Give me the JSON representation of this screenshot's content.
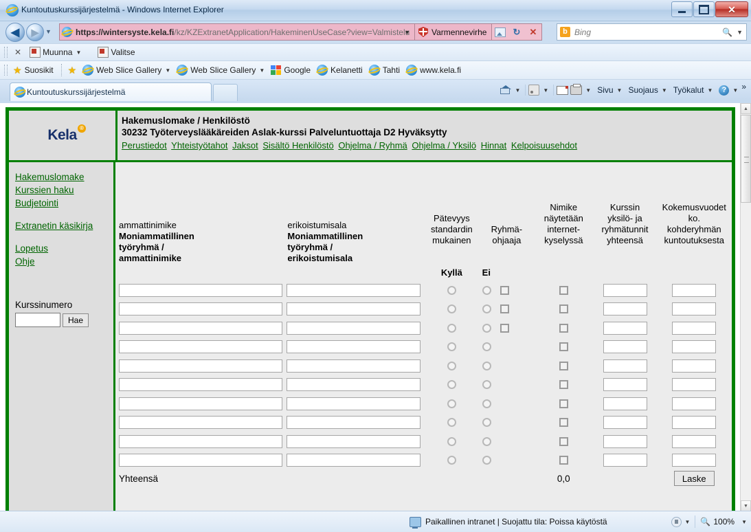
{
  "window": {
    "title": "Kuntoutuskurssijärjestelmä - Windows Internet Explorer",
    "minimize_label": "",
    "maximize_label": "",
    "close_label": "✕"
  },
  "navbar": {
    "back_label": "◀",
    "forward_label": "▶",
    "history_caret": "▼",
    "url_scheme": "https://",
    "url_host": "wintersyste.kela.fi",
    "url_path": "/kz/KZExtranetApplication/HakeminenUseCase?view=Valmistelu",
    "url_full": "https://wintersyste.kela.fi/kz/KZExtranetApplication/HakeminenUseCase?view=Valmistelu",
    "address_caret": "▼",
    "certificate_error": "Varmennevirhe",
    "compat_view_icon": "compatibility-view-icon",
    "refresh_icon": "↻",
    "stop_icon": "✕",
    "search_engine": "Bing",
    "search_placeholder": "Bing",
    "search_icon": "🔍",
    "search_caret": "▼"
  },
  "pdf_toolbar": {
    "close_label": "✕",
    "convert_label": "Muunna",
    "convert_caret": "▼",
    "select_label": "Valitse"
  },
  "favorites_bar": {
    "favorites_label": "Suosikit",
    "items": [
      {
        "label": "Web Slice Gallery",
        "caret": "▼"
      },
      {
        "label": "Web Slice Gallery",
        "caret": "▼"
      },
      {
        "label": "Google",
        "caret": ""
      },
      {
        "label": "Kelanetti",
        "caret": ""
      },
      {
        "label": "Tahti",
        "caret": ""
      },
      {
        "label": "www.kela.fi",
        "caret": ""
      }
    ]
  },
  "tabs": {
    "items": [
      {
        "label": "Kuntoutuskurssijärjestelmä"
      }
    ],
    "new_tab_label": ""
  },
  "command_bar": {
    "home_caret": "▼",
    "feeds_caret": "▼",
    "mail_caret": "▼",
    "print_caret": "▼",
    "page_label": "Sivu",
    "page_caret": "▼",
    "safety_label": "Suojaus",
    "safety_caret": "▼",
    "tools_label": "Työkalut",
    "tools_caret": "▼",
    "help_caret": "▼",
    "overflow_label": "»"
  },
  "page": {
    "brand": {
      "name": "Kela",
      "registered_mark": "®"
    },
    "header": {
      "line1": "Hakemuslomake / Henkilöstö",
      "line2": "30232 Työterveyslääkäreiden Aslak-kurssi Palveluntuottaja D2 Hyväksytty"
    },
    "nav_links": [
      "Perustiedot",
      "Yhteistyötahot",
      "Jaksot",
      "Sisältö Henkilöstö",
      "Ohjelma / Ryhmä",
      "Ohjelma / Yksilö",
      "Hinnat",
      "Kelpoisuusehdot"
    ],
    "sidebar": {
      "group1": [
        "Hakemuslomake",
        "Kurssien haku",
        "Budjetointi"
      ],
      "group2": [
        "Extranetin käsikirja"
      ],
      "group3": [
        "Lopetus",
        "Ohje"
      ],
      "course_number_label": "Kurssinumero",
      "course_number_value": "",
      "search_button_label": "Hae"
    },
    "table": {
      "headers": {
        "col1_small": "ammattinimike",
        "col1_bold": "Moniammatillinen työryhmä / ammattinimike",
        "col2_small": "erikoistumisala",
        "col2_bold": "Moniammatillinen työryhmä / erikoistumisala",
        "col3": "Pätevyys standardin mukainen",
        "col4": "Ryhmä- ohjaaja",
        "col5": "Nimike näytetään internet- kyselyssä",
        "col6": "Kurssin yksilö- ja ryhmätunnit yhteensä",
        "col7": "Kokemusvuodet ko. kohderyhmän kuntoutuksesta",
        "yes_label": "Kyllä",
        "no_label": "Ei"
      },
      "row_count": 10,
      "rows": [
        {
          "ammattinimike": "",
          "erikoistumisala": "",
          "has_group_checkbox": true,
          "tunnit": "",
          "kokemusvuodet": ""
        },
        {
          "ammattinimike": "",
          "erikoistumisala": "",
          "has_group_checkbox": true,
          "tunnit": "",
          "kokemusvuodet": ""
        },
        {
          "ammattinimike": "",
          "erikoistumisala": "",
          "has_group_checkbox": true,
          "tunnit": "",
          "kokemusvuodet": ""
        },
        {
          "ammattinimike": "",
          "erikoistumisala": "",
          "has_group_checkbox": false,
          "tunnit": "",
          "kokemusvuodet": ""
        },
        {
          "ammattinimike": "",
          "erikoistumisala": "",
          "has_group_checkbox": false,
          "tunnit": "",
          "kokemusvuodet": ""
        },
        {
          "ammattinimike": "",
          "erikoistumisala": "",
          "has_group_checkbox": false,
          "tunnit": "",
          "kokemusvuodet": ""
        },
        {
          "ammattinimike": "",
          "erikoistumisala": "",
          "has_group_checkbox": false,
          "tunnit": "",
          "kokemusvuodet": ""
        },
        {
          "ammattinimike": "",
          "erikoistumisala": "",
          "has_group_checkbox": false,
          "tunnit": "",
          "kokemusvuodet": ""
        },
        {
          "ammattinimike": "",
          "erikoistumisala": "",
          "has_group_checkbox": false,
          "tunnit": "",
          "kokemusvuodet": ""
        },
        {
          "ammattinimike": "",
          "erikoistumisala": "",
          "has_group_checkbox": false,
          "tunnit": "",
          "kokemusvuodet": ""
        }
      ],
      "total_label": "Yhteensä",
      "total_value": "0,0",
      "calculate_button_label": "Laske"
    }
  },
  "status_bar": {
    "zone_text": "Paikallinen intranet | Suojattu tila: Poissa käytöstä",
    "zoom_level": "100%",
    "zoom_caret": "▼",
    "protected_caret": "▼"
  },
  "colors": {
    "kela_green": "#008000",
    "link_green": "#006400",
    "kela_navy": "#17306b",
    "kela_orange": "#f0a500",
    "cert_error_pink": "#edb7c9",
    "page_gray": "#ececec"
  }
}
